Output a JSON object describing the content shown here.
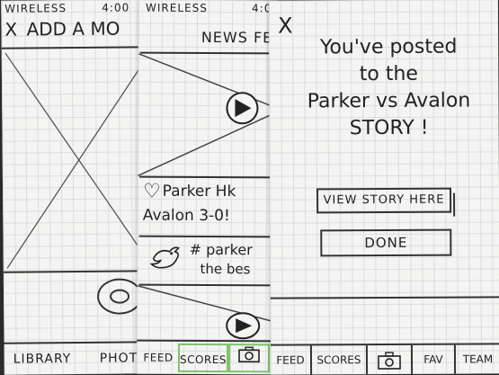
{
  "screen1": {
    "status": {
      "carrier": "WIRELESS",
      "time": "4:00"
    },
    "title": "ADD A MO",
    "close": "X",
    "tabs": [
      "LIBRARY",
      "PHOTO"
    ]
  },
  "screen2": {
    "status": {
      "carrier": "WIRELESS",
      "time": "4:00"
    },
    "header": "NEWS FE",
    "post1": {
      "line1": "Parker Hk",
      "line2": "Avalon 3-0!"
    },
    "post2": {
      "line1": "# parker",
      "line2": "the bes"
    },
    "tabs": [
      "FEED",
      "SCORES"
    ]
  },
  "screen3": {
    "close": "X",
    "message": {
      "line1": "You've posted",
      "line2": "to the",
      "line3": "Parker vs Avalon",
      "line4": "STORY !"
    },
    "view_story_label": "VIEW STORY HERE",
    "done_label": "DONE",
    "tabs": [
      "FEED",
      "SCORES",
      "FAV",
      "TEAM"
    ]
  },
  "colors": {
    "ink": "#333333",
    "paper": "#f4f4f2",
    "grid": "#dadde2",
    "active_tab": "#7fc36a"
  },
  "icons": [
    "close-icon",
    "image-placeholder-icon",
    "shutter-icon",
    "play-icon",
    "heart-icon",
    "bird-icon",
    "camera-icon"
  ]
}
